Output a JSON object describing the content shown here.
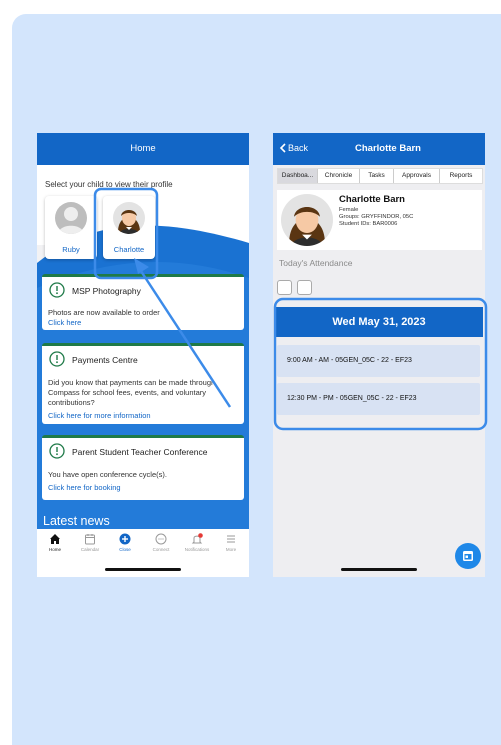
{
  "colors": {
    "brand": "#1266c6",
    "panel": "#d3e5fc",
    "accent_green": "#1f7a48",
    "highlight": "#3c8be9",
    "fab": "#1f88e8"
  },
  "left_phone": {
    "header_title": "Home",
    "select_prompt": "Select your child to view their profile",
    "children": [
      {
        "name": "Ruby",
        "avatar": "generic-person-icon"
      },
      {
        "name": "Charlotte",
        "avatar": "girl-avatar-icon"
      }
    ],
    "cards": [
      {
        "title": "MSP Photography",
        "text": "Photos are now available to order",
        "link": "Click here",
        "icon": "exclamation-circle-icon"
      },
      {
        "title": "Payments Centre",
        "text": "Did you know that payments can be made through Compass for school fees, events, and voluntary contributions?",
        "link": "Click here for more information",
        "icon": "exclamation-circle-icon"
      },
      {
        "title": "Parent Student Teacher Conference",
        "text": "You have open conference cycle(s).",
        "link": "Click here for booking",
        "icon": "exclamation-circle-icon"
      }
    ],
    "latest_news": "Latest news",
    "tabbar": [
      {
        "label": "Home",
        "icon": "home-icon"
      },
      {
        "label": "Calendar",
        "icon": "calendar-icon"
      },
      {
        "label": "Close",
        "icon": "plus-circle-icon"
      },
      {
        "label": "Connect",
        "icon": "chat-bubble-icon"
      },
      {
        "label": "Notifications",
        "icon": "bell-icon"
      },
      {
        "label": "More",
        "icon": "menu-icon"
      }
    ]
  },
  "right_phone": {
    "back_label": "Back",
    "header_title": "Charlotte  Barn",
    "tabs": [
      "Dashboa...",
      "Chronicle",
      "Tasks",
      "Approvals",
      "Reports"
    ],
    "profile": {
      "name": "Charlotte  Barn",
      "gender": "Female",
      "groups": "Groups: GRYFFINDOR, 05C",
      "student_ids": "Student IDs: BAR0006"
    },
    "attendance_label": "Today's Attendance",
    "date": "Wed May 31, 2023",
    "slots": [
      "9:00 AM - AM - 05GEN_05C - 22 - EF23",
      "12:30 PM - PM - 05GEN_05C - 22 - EF23"
    ],
    "fab_icon": "calendar-icon"
  }
}
